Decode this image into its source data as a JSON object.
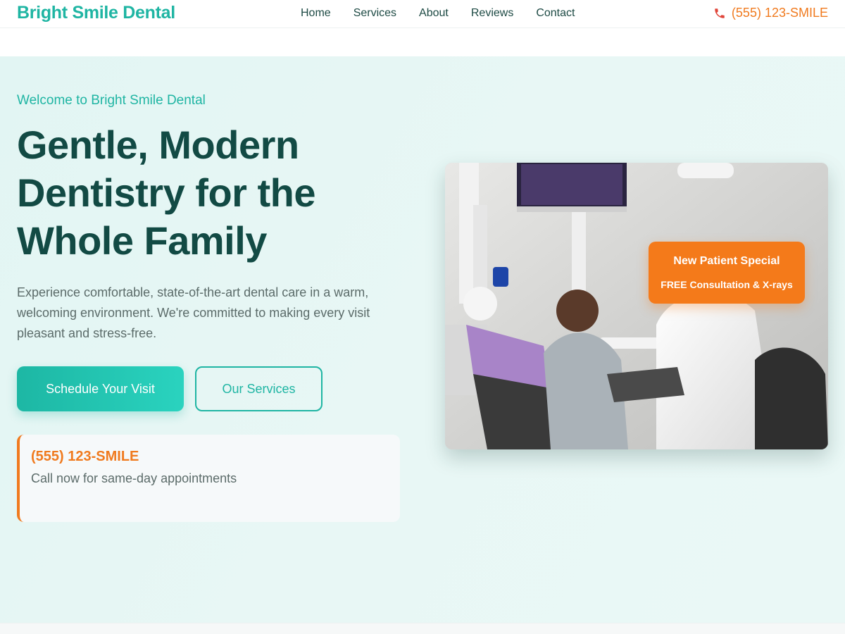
{
  "header": {
    "logo": "Bright Smile Dental",
    "nav": [
      "Home",
      "Services",
      "About",
      "Reviews",
      "Contact"
    ],
    "phone": "(555) 123-SMILE",
    "phone_icon": "phone-icon"
  },
  "hero": {
    "eyebrow": "Welcome to Bright Smile Dental",
    "headline": "Gentle, Modern Dentistry for the Whole Family",
    "lede": "Experience comfortable, state-of-the-art dental care in a warm, welcoming environment. We're committed to making every visit pleasant and stress-free.",
    "primary_button": "Schedule Your Visit",
    "secondary_button": "Our Services",
    "call_card": {
      "phone": "(555) 123-SMILE",
      "note": "Call now for same-day appointments"
    }
  },
  "promo": {
    "title": "New Patient Special",
    "subtitle": "FREE Consultation & X-rays"
  },
  "colors": {
    "brand_teal": "#1fb5a3",
    "headline_green": "#124a44",
    "accent_orange": "#f07a1e",
    "hero_bg": "#e6f7f5"
  }
}
